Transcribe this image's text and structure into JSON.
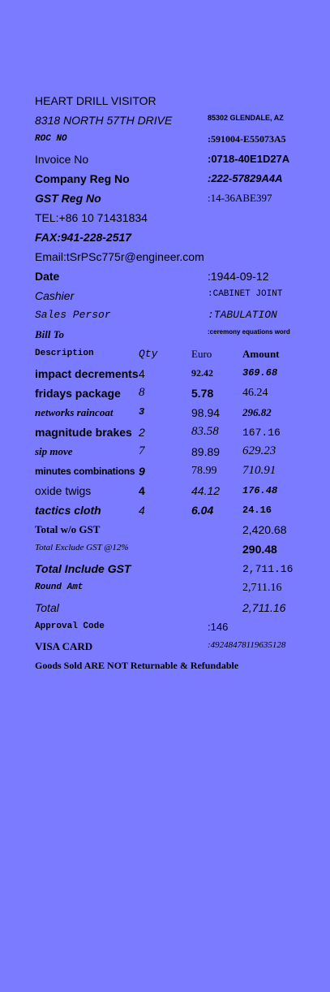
{
  "header": {
    "company": "HEART DRILL VISITOR",
    "address": "8318 NORTH 57TH DRIVE",
    "city": "85302 GLENDALE, AZ",
    "roc_label": "ROC NO",
    "roc_value": ":591004-E55073A5",
    "invoice_label": "Invoice No",
    "invoice_value": ":0718-40E1D27A",
    "company_reg_label": "Company Reg No",
    "company_reg_value": ":222-57829A4A",
    "gst_reg_label": "GST Reg No",
    "gst_reg_value": ":14-36ABE397",
    "tel": "TEL:+86 10 71431834",
    "fax": "FAX:941-228-2517",
    "email": "Email:tSrPSc775r@engineer.com"
  },
  "meta": {
    "date_label": "Date",
    "date_value": ":1944-09-12",
    "cashier_label": "Cashier",
    "cashier_value": ":CABINET JOINT",
    "sales_label": "Sales Persor",
    "sales_value": ":TABULATION",
    "bill_label": "Bill To",
    "bill_value": ":ceremony equations word"
  },
  "table": {
    "headers": {
      "description": "Description",
      "qty": "Qty",
      "price": "Euro",
      "amount": "Amount"
    },
    "rows": [
      {
        "description": "impact decrements",
        "qty": "4",
        "price": "92.42",
        "amount": "369.68"
      },
      {
        "description": "fridays package",
        "qty": "8",
        "price": "5.78",
        "amount": "46.24"
      },
      {
        "description": "networks raincoat",
        "qty": "3",
        "price": "98.94",
        "amount": "296.82"
      },
      {
        "description": "magnitude brakes",
        "qty": "2",
        "price": "83.58",
        "amount": "167.16"
      },
      {
        "description": "sip move",
        "qty": "7",
        "price": "89.89",
        "amount": "629.23"
      },
      {
        "description": "minutes combinations",
        "qty": "9",
        "price": "78.99",
        "amount": "710.91"
      },
      {
        "description": "oxide twigs",
        "qty": "4",
        "price": "44.12",
        "amount": "176.48"
      },
      {
        "description": "tactics cloth",
        "qty": "4",
        "price": "6.04",
        "amount": "24.16"
      }
    ]
  },
  "totals": {
    "wo_gst_label": "Total w/o GST",
    "wo_gst_value": "2,420.68",
    "exclude_label": "Total Exclude GST @12%",
    "exclude_value": "290.48",
    "include_label": "Total Include GST",
    "include_value": "2,711.16",
    "round_label": "Round Amt",
    "round_value": "2,711.16",
    "total_label": "Total",
    "total_value": "2,711.16"
  },
  "payment": {
    "approval_label": "Approval Code",
    "approval_value": ":146",
    "card_label": "VISA CARD",
    "card_value": ":49248478119635128"
  },
  "footer": {
    "notice": "Goods Sold ARE NOT Returnable & Refundable"
  }
}
